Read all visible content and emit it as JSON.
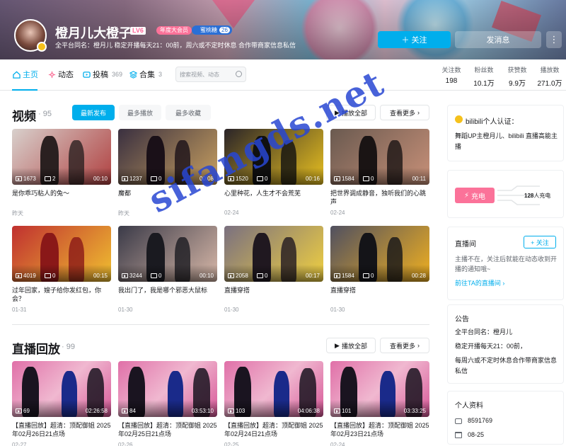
{
  "header": {
    "username": "橙月儿大橙子",
    "level": "LV6",
    "year_tag": "年度大会员",
    "fan_tag": "蜜桃糖",
    "fan_level": "26",
    "bio": "全平台同名：橙月儿 稳定开播每天21：00前，周六或不定时休息 合作带商家信息私信",
    "follow_label": "关注",
    "message_label": "发消息",
    "more_label": "⋮"
  },
  "nav": {
    "items": [
      {
        "label": "主页",
        "count": ""
      },
      {
        "label": "动态",
        "count": ""
      },
      {
        "label": "投稿",
        "count": "369"
      },
      {
        "label": "合集",
        "count": "3"
      }
    ],
    "search_placeholder": "搜索视频、动态",
    "stats": [
      {
        "label": "关注数",
        "value": "198"
      },
      {
        "label": "粉丝数",
        "value": "10.1万"
      },
      {
        "label": "获赞数",
        "value": "9.9万"
      },
      {
        "label": "播放数",
        "value": "271.0万"
      }
    ]
  },
  "videos": {
    "title": "视频",
    "count": "· 95",
    "tabs": [
      "最新发布",
      "最多播放",
      "最多收藏"
    ],
    "play_all": "播放全部",
    "see_more": "查看更多",
    "items": [
      {
        "plays": "1673",
        "danmu": "2",
        "duration": "00:10",
        "title": "是你乖巧粘人的兔～",
        "date": "昨天"
      },
      {
        "plays": "1237",
        "danmu": "0",
        "duration": "00:08",
        "title": "魔都",
        "date": "昨天"
      },
      {
        "plays": "1520",
        "danmu": "0",
        "duration": "00:16",
        "title": "心里种花，人生才不会荒芜",
        "date": "02-24"
      },
      {
        "plays": "1584",
        "danmu": "0",
        "duration": "00:11",
        "title": "把世界调成静音，独听我们的心跳声",
        "date": "02-24"
      },
      {
        "plays": "4019",
        "danmu": "0",
        "duration": "00:15",
        "title": "过年回家，嫂子给你发红包，你会？",
        "date": "01-31"
      },
      {
        "plays": "3244",
        "danmu": "0",
        "duration": "00:10",
        "title": "我出门了，我是哪个邪恶大鼠标",
        "date": "01-30"
      },
      {
        "plays": "2058",
        "danmu": "0",
        "duration": "00:17",
        "title": "直播穿搭",
        "date": "01-30"
      },
      {
        "plays": "1584",
        "danmu": "0",
        "duration": "00:28",
        "title": "直播穿搭",
        "date": "01-30"
      }
    ]
  },
  "replays": {
    "title": "直播回放",
    "count": "· 99",
    "play_all": "播放全部",
    "see_more": "查看更多",
    "items": [
      {
        "plays": "69",
        "duration": "02:26:58",
        "title": "【直播回放】超清：顶配御姐 2025年02月26日21点场",
        "date": "02-27"
      },
      {
        "plays": "84",
        "duration": "03:53:10",
        "title": "【直播回放】超清：顶配御姐 2025年02月25日21点场",
        "date": "02-26"
      },
      {
        "plays": "103",
        "duration": "04:06:38",
        "title": "【直播回放】超清：顶配御姐 2025年02月24日21点场",
        "date": "02-25"
      },
      {
        "plays": "101",
        "duration": "03:33:25",
        "title": "【直播回放】超清：顶配御姐 2025年02月23日21点场",
        "date": "02-24"
      }
    ]
  },
  "sidebar": {
    "cert_title": "bilibili个人认证：",
    "cert_text": "舞蹈UP主橙月儿、bilibili 直播高能主播",
    "charge_label": "充电",
    "charge_count": "128",
    "charge_suffix": "人充电",
    "live_title": "直播间",
    "live_follow": "+ 关注",
    "live_text": "主播不在，关注后就能在动态收到开播的通知哦~",
    "live_link": "前往TA的直播间",
    "notice_title": "公告",
    "notice_lines": [
      "全平台同名：橙月儿",
      "稳定开播每天21：00前，",
      "每周六或不定时休息合作带商家信息私信"
    ],
    "profile_title": "个人资料",
    "uid": "8591769",
    "birthday": "08-25"
  },
  "watermark": "sifangds.net"
}
